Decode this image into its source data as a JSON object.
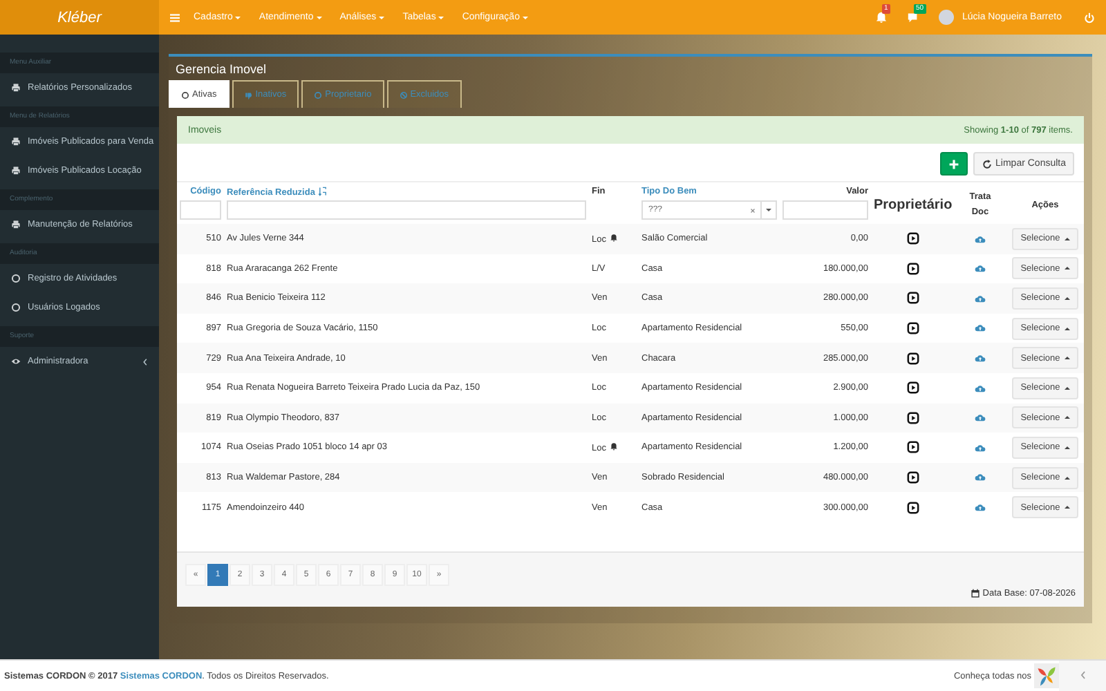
{
  "topbar": {
    "brand": "Kléber",
    "menu": [
      {
        "label": "Cadastro"
      },
      {
        "label": "Atendimento"
      },
      {
        "label": "Análises"
      },
      {
        "label": "Tabelas"
      },
      {
        "label": "Configuração"
      }
    ],
    "notifications": "1",
    "messages": "50",
    "user": "Lúcia Nogueira Barreto"
  },
  "sidebar": {
    "sections": [
      {
        "label": "Menu Auxiliar",
        "items": [
          {
            "label": "Relatórios Personalizados",
            "kind": "printer"
          }
        ]
      },
      {
        "label": "Menu de Relatórios",
        "items": [
          {
            "label": "Imóveis Publicados para Venda",
            "kind": "printer"
          },
          {
            "label": "Imóveis Publicados Locação",
            "kind": "printer"
          }
        ]
      },
      {
        "label": "Complemento",
        "items": [
          {
            "label": "Manutenção de Relatórios",
            "kind": "printer"
          }
        ]
      },
      {
        "label": "Auditoria",
        "items": [
          {
            "label": "Registro de Atividades",
            "kind": "circle"
          },
          {
            "label": "Usuários Logados",
            "kind": "circle"
          }
        ]
      },
      {
        "label": "Suporte",
        "items": [
          {
            "label": "Administradora",
            "kind": "eye",
            "expandable": true
          }
        ]
      }
    ]
  },
  "page": {
    "title": "Gerencia Imovel",
    "tabs": [
      {
        "label": "Ativas",
        "kind": "circle",
        "selected": true
      },
      {
        "label": "Inativos",
        "kind": "thumb",
        "selected": false
      },
      {
        "label": "Proprietario",
        "kind": "circle",
        "selected": false
      },
      {
        "label": "Excluidos",
        "kind": "ban",
        "selected": false
      }
    ],
    "panel": {
      "title": "Imoveis",
      "summary": "Showing **1-10** of **797** items.",
      "clear_button": "Limpar Consulta"
    },
    "table": {
      "columns": [
        "Código",
        "Referência Reduzida",
        "Fin",
        "Tipo Do Bem",
        "Valor",
        "Proprietário",
        "Trata Doc",
        "Ações"
      ],
      "filter_tipo": "???",
      "rows": [
        {
          "codigo": "510",
          "referencia": "Av Jules Verne 344",
          "fin": "Loc",
          "alert": true,
          "tipo": "Salão Comercial",
          "valor": "0,00",
          "action": "Selecione"
        },
        {
          "codigo": "818",
          "referencia": "Rua Araracanga 262 Frente",
          "fin": "L/V",
          "alert": false,
          "tipo": "Casa",
          "valor": "180.000,00",
          "action": "Selecione"
        },
        {
          "codigo": "846",
          "referencia": "Rua Benicio Teixeira 112",
          "fin": "Ven",
          "alert": false,
          "tipo": "Casa",
          "valor": "280.000,00",
          "action": "Selecione"
        },
        {
          "codigo": "897",
          "referencia": "Rua Gregoria de Souza Vacário, 1150",
          "fin": "Loc",
          "alert": false,
          "tipo": "Apartamento Residencial",
          "valor": "550,00",
          "action": "Selecione"
        },
        {
          "codigo": "729",
          "referencia": "Rua Ana Teixeira Andrade, 10",
          "fin": "Ven",
          "alert": false,
          "tipo": "Chacara",
          "valor": "285.000,00",
          "action": "Selecione"
        },
        {
          "codigo": "954",
          "referencia": "Rua Renata Nogueira Barreto Teixeira Prado Lucia da Paz, 150",
          "fin": "Loc",
          "alert": false,
          "tipo": "Apartamento Residencial",
          "valor": "2.900,00",
          "action": "Selecione"
        },
        {
          "codigo": "819",
          "referencia": "Rua Olympio Theodoro, 837",
          "fin": "Loc",
          "alert": false,
          "tipo": "Apartamento Residencial",
          "valor": "1.000,00",
          "action": "Selecione"
        },
        {
          "codigo": "1074",
          "referencia": "Rua Oseias Prado 1051 bloco 14 apr 03",
          "fin": "Loc",
          "alert": true,
          "tipo": "Apartamento Residencial",
          "valor": "1.200,00",
          "action": "Selecione"
        },
        {
          "codigo": "813",
          "referencia": "Rua Waldemar Pastore, 284",
          "fin": "Ven",
          "alert": false,
          "tipo": "Sobrado Residencial",
          "valor": "480.000,00",
          "action": "Selecione"
        },
        {
          "codigo": "1175",
          "referencia": "Amendoinzeiro 440",
          "fin": "Ven",
          "alert": false,
          "tipo": "Casa",
          "valor": "300.000,00",
          "action": "Selecione"
        }
      ]
    },
    "pagination": [
      {
        "label": "«",
        "selected": false
      },
      {
        "label": "1",
        "selected": true
      },
      {
        "label": "2",
        "selected": false
      },
      {
        "label": "3",
        "selected": false
      },
      {
        "label": "4",
        "selected": false
      },
      {
        "label": "5",
        "selected": false
      },
      {
        "label": "6",
        "selected": false
      },
      {
        "label": "7",
        "selected": false
      },
      {
        "label": "8",
        "selected": false
      },
      {
        "label": "9",
        "selected": false
      },
      {
        "label": "10",
        "selected": false
      },
      {
        "label": "»",
        "selected": false
      }
    ],
    "data_base": "Data Base: 07-08-2026"
  },
  "footer": {
    "owner": "Sistemas CORDON © 2017",
    "link": "Sistemas CORDON",
    "rights": ". Todos os Direitos Reservados.",
    "promo": "Conheça todas nos"
  }
}
